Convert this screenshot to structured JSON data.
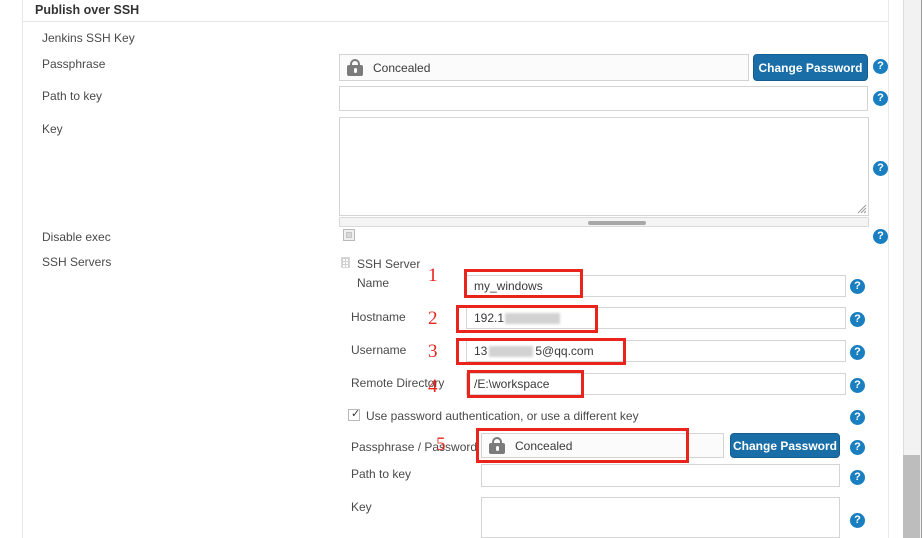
{
  "section": {
    "title": "Publish over SSH"
  },
  "jenkins_key": {
    "group_label": "Jenkins SSH Key",
    "passphrase": {
      "label": "Passphrase",
      "value": "Concealed",
      "lock_icon": "lock-icon",
      "change_button": "Change Password"
    },
    "path_to_key": {
      "label": "Path to key",
      "value": "",
      "placeholder": ""
    },
    "key": {
      "label": "Key",
      "value": "",
      "placeholder": ""
    }
  },
  "disable_exec": {
    "label": "Disable exec",
    "checked": false
  },
  "ssh_servers": {
    "label": "SSH Servers",
    "block_title": "SSH Server",
    "grip_icon": "drag-handle-icon",
    "fields": {
      "name": {
        "label": "Name",
        "value": "my_windows"
      },
      "hostname": {
        "label": "Hostname",
        "value_prefix": "192.1",
        "value_redacted": true
      },
      "username": {
        "label": "Username",
        "value_prefix": "13",
        "value_suffix": "5@qq.com",
        "value_redacted": true
      },
      "remote_directory": {
        "label": "Remote Directory",
        "value": "/E:\\workspace"
      }
    },
    "use_password_auth": {
      "label": "Use password authentication, or use a different key",
      "checked": true
    },
    "passphrase_password": {
      "label": "Passphrase / Password",
      "value": "Concealed",
      "lock_icon": "lock-icon",
      "change_button": "Change Password"
    },
    "path_to_key": {
      "label": "Path to key",
      "value": ""
    },
    "key": {
      "label": "Key",
      "value": ""
    }
  },
  "help": {
    "glyph": "?"
  },
  "annotations": {
    "numbers": [
      "1",
      "2",
      "3",
      "4",
      "5"
    ],
    "color": "#e8241c"
  },
  "colors": {
    "accent_blue": "#1a7fc1",
    "button_blue": "#1a6ea8",
    "annotation_red": "#e8241c",
    "border_grey": "#d4d4d4"
  }
}
